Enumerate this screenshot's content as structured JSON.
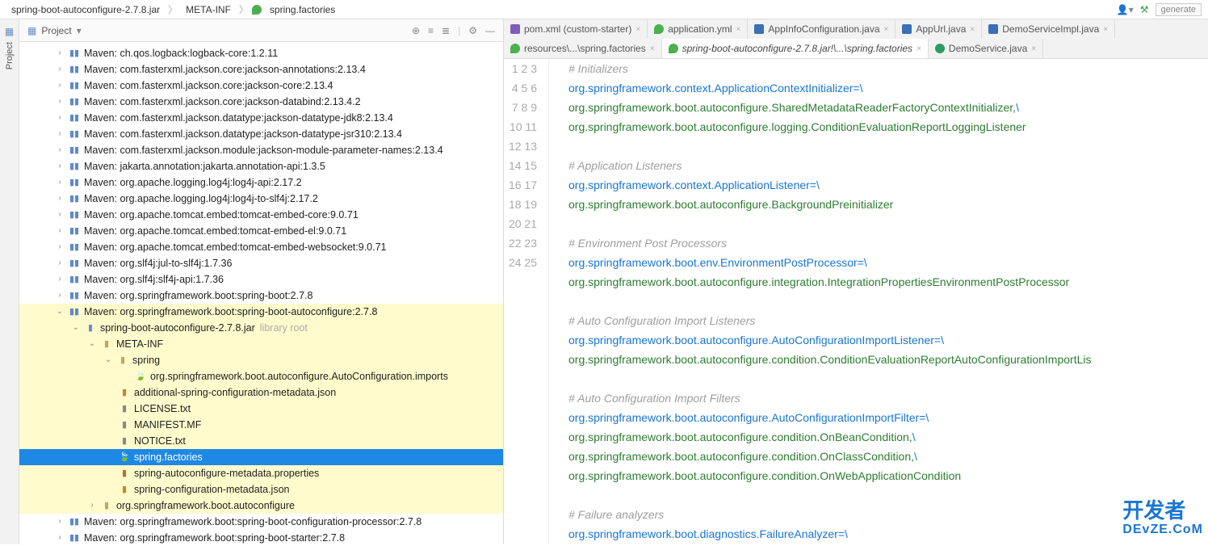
{
  "breadcrumb": {
    "c1": "spring-boot-autoconfigure-2.7.8.jar",
    "c2": "META-INF",
    "c3": "spring.factories"
  },
  "top_right": {
    "generate": "generate"
  },
  "panel": {
    "title": "Project"
  },
  "gutter": {
    "project": "Project"
  },
  "tree": {
    "lib0": "Maven: ch.qos.logback:logback-core:1.2.11",
    "lib1": "Maven: com.fasterxml.jackson.core:jackson-annotations:2.13.4",
    "lib2": "Maven: com.fasterxml.jackson.core:jackson-core:2.13.4",
    "lib3": "Maven: com.fasterxml.jackson.core:jackson-databind:2.13.4.2",
    "lib4": "Maven: com.fasterxml.jackson.datatype:jackson-datatype-jdk8:2.13.4",
    "lib5": "Maven: com.fasterxml.jackson.datatype:jackson-datatype-jsr310:2.13.4",
    "lib6": "Maven: com.fasterxml.jackson.module:jackson-module-parameter-names:2.13.4",
    "lib7": "Maven: jakarta.annotation:jakarta.annotation-api:1.3.5",
    "lib8": "Maven: org.apache.logging.log4j:log4j-api:2.17.2",
    "lib9": "Maven: org.apache.logging.log4j:log4j-to-slf4j:2.17.2",
    "lib10": "Maven: org.apache.tomcat.embed:tomcat-embed-core:9.0.71",
    "lib11": "Maven: org.apache.tomcat.embed:tomcat-embed-el:9.0.71",
    "lib12": "Maven: org.apache.tomcat.embed:tomcat-embed-websocket:9.0.71",
    "lib13": "Maven: org.slf4j:jul-to-slf4j:1.7.36",
    "lib14": "Maven: org.slf4j:slf4j-api:1.7.36",
    "lib15": "Maven: org.springframework.boot:spring-boot:2.7.8",
    "lib16": "Maven: org.springframework.boot:spring-boot-autoconfigure:2.7.8",
    "jar": "spring-boot-autoconfigure-2.7.8.jar",
    "jar_hint": "library root",
    "metainf": "META-INF",
    "spring": "spring",
    "imports": "org.springframework.boot.autoconfigure.AutoConfiguration.imports",
    "addl": "additional-spring-configuration-metadata.json",
    "license": "LICENSE.txt",
    "manifest": "MANIFEST.MF",
    "notice": "NOTICE.txt",
    "factories": "spring.factories",
    "autometa": "spring-autoconfigure-metadata.properties",
    "confmeta": "spring-configuration-metadata.json",
    "autopkg": "org.springframework.boot.autoconfigure",
    "lib17": "Maven: org.springframework.boot:spring-boot-configuration-processor:2.7.8",
    "lib18": "Maven: org.springframework.boot:spring-boot-starter:2.7.8"
  },
  "tabs1": {
    "t0": "pom.xml (custom-starter)",
    "t1": "application.yml",
    "t2": "AppInfoConfiguration.java",
    "t3": "AppUrl.java",
    "t4": "DemoServiceImpl.java"
  },
  "tabs2": {
    "t0": "resources\\...\\spring.factories",
    "t1": "spring-boot-autoconfigure-2.7.8.jar!\\...\\spring.factories",
    "t2": "DemoService.java"
  },
  "code": {
    "l1": "# Initializers",
    "l2k": "org.springframework.context.ApplicationContextInitializer=",
    "l2c": "\\",
    "l3": "org.springframework.boot.autoconfigure.SharedMetadataReaderFactoryContextInitializer,",
    "l3c": "\\",
    "l4": "org.springframework.boot.autoconfigure.logging.ConditionEvaluationReportLoggingListener",
    "l6": "# Application Listeners",
    "l7k": "org.springframework.context.ApplicationListener=",
    "l7c": "\\",
    "l8": "org.springframework.boot.autoconfigure.BackgroundPreinitializer",
    "l10": "# Environment Post Processors",
    "l11k": "org.springframework.boot.env.EnvironmentPostProcessor=",
    "l11c": "\\",
    "l12": "org.springframework.boot.autoconfigure.integration.IntegrationPropertiesEnvironmentPostProcessor",
    "l14": "# Auto Configuration Import Listeners",
    "l15k": "org.springframework.boot.autoconfigure.AutoConfigurationImportListener=",
    "l15c": "\\",
    "l16": "org.springframework.boot.autoconfigure.condition.ConditionEvaluationReportAutoConfigurationImportLis",
    "l18": "# Auto Configuration Import Filters",
    "l19k": "org.springframework.boot.autoconfigure.AutoConfigurationImportFilter=",
    "l19c": "\\",
    "l20": "org.springframework.boot.autoconfigure.condition.OnBeanCondition,",
    "l20c": "\\",
    "l21": "org.springframework.boot.autoconfigure.condition.OnClassCondition,",
    "l21c": "\\",
    "l22": "org.springframework.boot.autoconfigure.condition.OnWebApplicationCondition",
    "l24": "# Failure analyzers",
    "l25k": "org.springframework.boot.diagnostics.FailureAnalyzer=",
    "l25c": "\\"
  },
  "watermark": {
    "l1": "开发者",
    "l2": "DEvZE.CoM"
  }
}
